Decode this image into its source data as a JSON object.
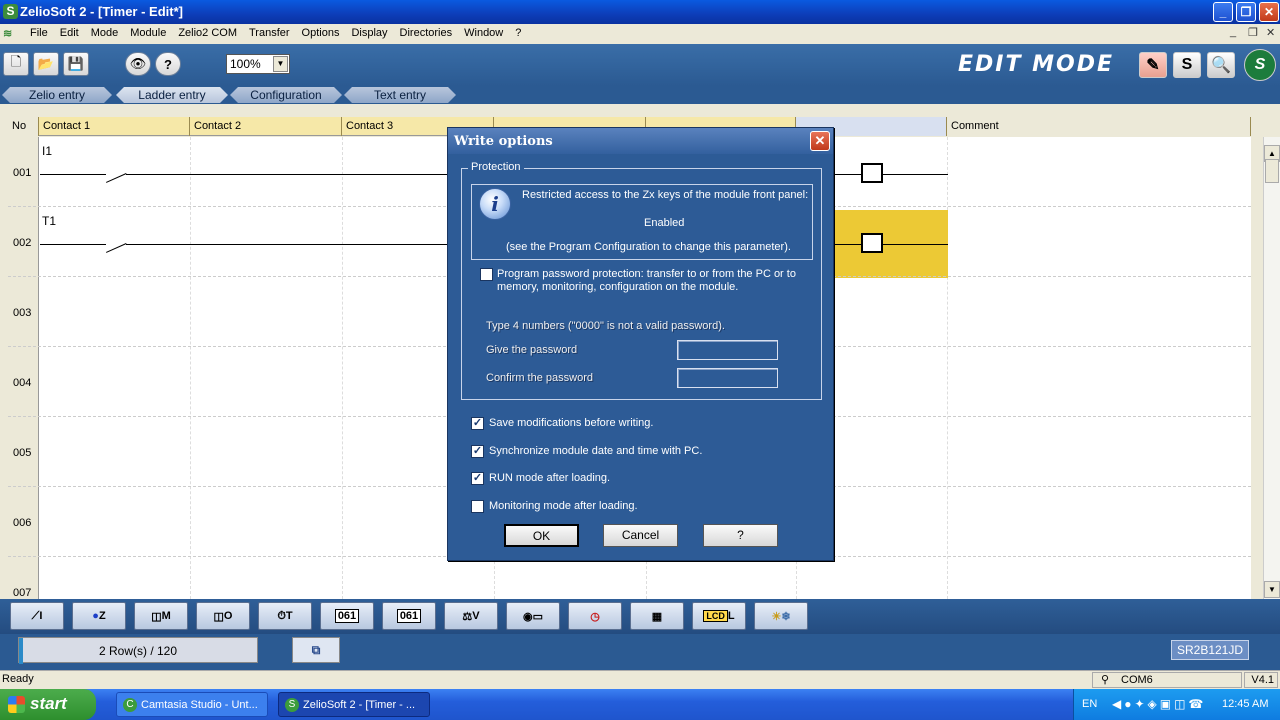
{
  "window": {
    "title": "ZelioSoft 2 - [Timer - Edit*]",
    "app_icon": "S",
    "controls": [
      "_",
      "❐",
      "✕"
    ]
  },
  "menu": {
    "items": [
      "File",
      "Edit",
      "Mode",
      "Module",
      "Zelio2 COM",
      "Transfer",
      "Options",
      "Display",
      "Directories",
      "Window",
      "?"
    ],
    "mdi_controls": [
      "_",
      "❐",
      "✕"
    ]
  },
  "toolbar": {
    "zoom": "100%",
    "mode_label": "EDIT MODE",
    "mode_buttons": [
      "✎",
      "S",
      "🔍"
    ]
  },
  "tabs": [
    "Zelio entry",
    "Ladder entry",
    "Configuration",
    "Text entry"
  ],
  "grid": {
    "columns": [
      "No",
      "Contact 1",
      "Contact 2",
      "Contact 3",
      "Comment"
    ],
    "rows": [
      "001",
      "002",
      "003",
      "004",
      "005",
      "006",
      "007"
    ],
    "contacts": [
      {
        "row": "001",
        "label": "I1"
      },
      {
        "row": "002",
        "label": "T1"
      }
    ]
  },
  "function_blocks": [
    {
      "name": "contact",
      "label": "I"
    },
    {
      "name": "zx-key",
      "label": "Z"
    },
    {
      "name": "aux-relay",
      "label": "M"
    },
    {
      "name": "output",
      "label": "O"
    },
    {
      "name": "timer",
      "label": "T"
    },
    {
      "name": "counter",
      "label": "061"
    },
    {
      "name": "fast-counter",
      "label": "061"
    },
    {
      "name": "comparator",
      "label": "V"
    },
    {
      "name": "analog",
      "label": ""
    },
    {
      "name": "clock",
      "label": ""
    },
    {
      "name": "text",
      "label": ""
    },
    {
      "name": "lcd",
      "label": "L"
    },
    {
      "name": "summer-winter",
      "label": ""
    }
  ],
  "status_strip": {
    "row_count": "2 Row(s) / 120",
    "module_ref": "SR2B121JD"
  },
  "statusbar": {
    "ready": "Ready",
    "com": "COM6",
    "version": "V4.1"
  },
  "taskbar": {
    "start": "start",
    "tasks": [
      "Camtasia Studio - Unt...",
      "ZelioSoft 2 - [Timer - ..."
    ],
    "lang": "EN",
    "clock": "12:45 AM"
  },
  "dialog": {
    "title": "Write options",
    "protection_legend": "Protection",
    "info_line1": "Restricted access to the Zx keys of the module front panel:",
    "info_line2": "Enabled",
    "info_line3": "(see the Program Configuration to change this parameter).",
    "password_protect_line1": "Program password protection: transfer to or from the PC or to",
    "password_protect_line2": "memory, monitoring, configuration on the module.",
    "password_hint": "Type 4 numbers (\"0000\" is not a valid password).",
    "give_password": "Give the password",
    "confirm_password": "Confirm the password",
    "options": [
      {
        "label": "Save modifications before writing.",
        "checked": true
      },
      {
        "label": "Synchronize module date and time with PC.",
        "checked": true
      },
      {
        "label": "RUN mode after loading.",
        "checked": true
      },
      {
        "label": "Monitoring mode after loading.",
        "checked": false
      }
    ],
    "buttons": {
      "ok": "OK",
      "cancel": "Cancel",
      "help": "?"
    }
  }
}
